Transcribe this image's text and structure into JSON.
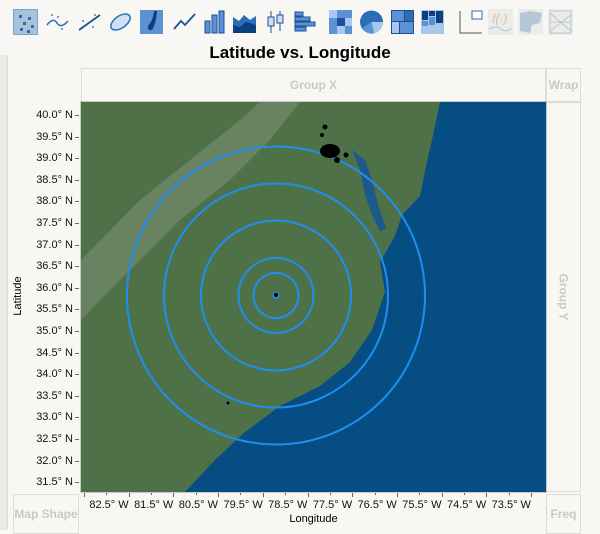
{
  "toolbar": {
    "icons": [
      "points",
      "smoother",
      "line-of-fit",
      "ellipse",
      "contour",
      "line",
      "bar",
      "area",
      "box-plot",
      "histogram",
      "heatmap",
      "pie",
      "treemap",
      "mosaic",
      "caption-box",
      "formula",
      "map-shapes",
      "parallel"
    ],
    "selected": "points"
  },
  "title": "Latitude vs. Longitude",
  "dropzones": {
    "group_x": "Group X",
    "wrap": "Wrap",
    "group_y": "Group Y",
    "map_shape": "Map Shape",
    "freq": "Freq"
  },
  "y_axis": {
    "label": "Latitude",
    "ticks": [
      "40.0° N",
      "39.5° N",
      "39.0° N",
      "38.5° N",
      "38.0° N",
      "37.5° N",
      "37.0° N",
      "36.5° N",
      "36.0° N",
      "35.5° N",
      "35.0° N",
      "34.5° N",
      "34.0° N",
      "33.5° N",
      "33.0° N",
      "32.5° N",
      "32.0° N",
      "31.5° N"
    ]
  },
  "x_axis": {
    "label": "Longitude",
    "ticks": [
      "82.5° W",
      "81.5° W",
      "80.5° W",
      "79.5° W",
      "78.5° W",
      "77.5° W",
      "76.5° W",
      "75.5° W",
      "74.5° W",
      "73.5° W"
    ]
  },
  "colors": {
    "land": "#4f7148",
    "sea": "#064d84",
    "ring": "#1e8ff0",
    "accent": "#2d6db5"
  }
}
